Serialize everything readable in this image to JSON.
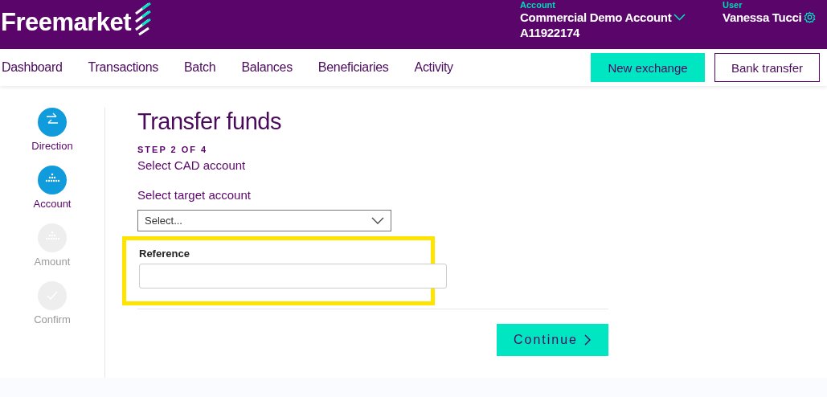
{
  "header": {
    "logo": "Freemarket",
    "account_label": "Account",
    "account_name": "Commercial Demo Account",
    "account_id": "A11922174",
    "user_label": "User",
    "user_name": "Vanessa Tucci"
  },
  "nav": {
    "items": [
      "Dashboard",
      "Transactions",
      "Batch",
      "Balances",
      "Beneficiaries",
      "Activity"
    ],
    "buttons": [
      {
        "label": "New exchange",
        "kind": "primary"
      },
      {
        "label": "Bank transfer",
        "kind": "outline"
      }
    ]
  },
  "steps": [
    {
      "label": "Direction",
      "active": true
    },
    {
      "label": "Account",
      "active": true
    },
    {
      "label": "Amount",
      "active": false
    },
    {
      "label": "Confirm",
      "active": false
    }
  ],
  "form": {
    "title": "Transfer funds",
    "step": "STEP 2 OF 4",
    "subtitle": "Select CAD account",
    "target_label": "Select target account",
    "target_placeholder": "Select...",
    "reference_label": "Reference",
    "reference_highlighted": true,
    "continue": "Continue"
  }
}
